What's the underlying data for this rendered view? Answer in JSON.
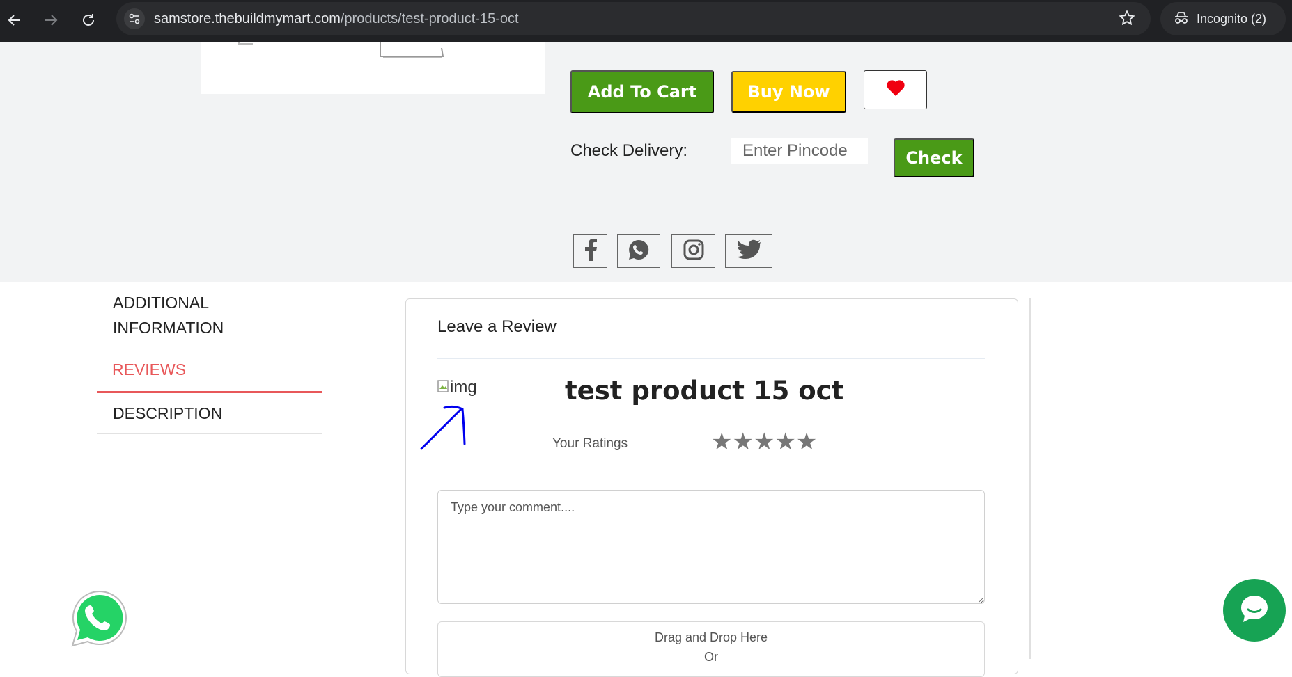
{
  "browser": {
    "url_host": "samstore.thebuildmymart.com",
    "url_path": "/products/test-product-15-oct",
    "incognito_label": "Incognito (2)"
  },
  "product_actions": {
    "add_to_cart": "Add To Cart",
    "buy_now": "Buy Now",
    "check_delivery_label": "Check Delivery:",
    "pincode_placeholder": "Enter Pincode",
    "check_button": "Check"
  },
  "share": {
    "icons": [
      "facebook-icon",
      "whatsapp-icon",
      "instagram-icon",
      "twitter-icon"
    ]
  },
  "tabs": {
    "additional_line1": "ADDITIONAL",
    "additional_line2": "INFORMATION",
    "reviews": "REVIEWS",
    "description": "DESCRIPTION",
    "active": "REVIEWS"
  },
  "review": {
    "heading": "Leave a Review",
    "image_alt": "img",
    "product_name": "test product 15 oct",
    "ratings_label": "Your Ratings",
    "stars": "★★★★★",
    "comment_placeholder": "Type your comment....",
    "drop_text": "Drag and Drop Here",
    "drop_or": "Or"
  },
  "colors": {
    "accent_green": "#4a9a17",
    "buy_yellow": "#ffd100",
    "active_tab": "#e8585a",
    "chat_green": "#17a354",
    "annotation_blue": "#0000ee"
  }
}
